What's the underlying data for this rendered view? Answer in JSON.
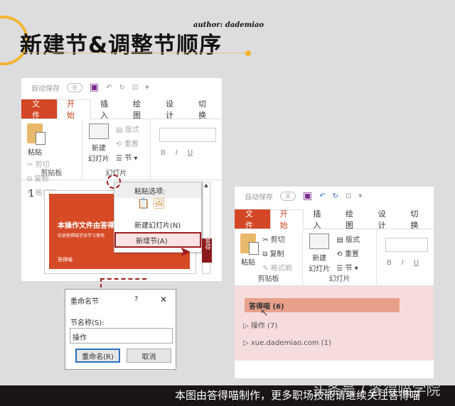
{
  "banner": {
    "title": "新建节&调整节顺序",
    "author": "author: dademiao"
  },
  "left_window": {
    "qat": {
      "autosave": "自动保存",
      "toggle": "关"
    },
    "tabs": [
      "文件",
      "开始",
      "插入",
      "绘图",
      "设计",
      "切换"
    ],
    "clipboard": {
      "paste": "粘贴",
      "cut": "剪切",
      "copy": "复制",
      "format_painter": "格式刷",
      "group": "剪贴板"
    },
    "slides": {
      "new_slide_1": "新建",
      "new_slide_2": "幻灯片",
      "layout": "版式",
      "reset": "重置",
      "section": "节",
      "group": "幻灯片"
    },
    "font": {
      "bold": "B",
      "italic": "I",
      "underline": "U"
    },
    "slide_number": "1",
    "thumb_title": "本操作文件由答得",
    "thumb_sub": "仅供答得喵学员学习使用",
    "thumb_logo": "答得喵",
    "context_menu": {
      "paste_options": "粘贴选项:",
      "new_slide": "新建幻灯片(N)",
      "add_section": "新增节(A)"
    },
    "badge": "答得"
  },
  "dialog": {
    "title": "重命名节",
    "help": "?",
    "close": "✕",
    "label": "节名称(S):",
    "value": "操作",
    "rename": "重命名(R)",
    "cancel": "取消"
  },
  "right_window": {
    "qat": {
      "autosave": "自动保存",
      "toggle": "关"
    },
    "tabs": [
      "文件",
      "开始",
      "插入",
      "绘图",
      "设计",
      "切换"
    ],
    "clipboard": {
      "paste": "粘贴",
      "cut": "剪切",
      "copy": "复制",
      "format_painter": "格式刷",
      "group": "剪贴板"
    },
    "slides": {
      "new_slide_1": "新建",
      "new_slide_2": "幻灯片",
      "layout": "版式",
      "reset": "重置",
      "section": "节",
      "group": "幻灯片"
    },
    "font": {
      "bold": "B",
      "italic": "I",
      "underline": "U"
    },
    "sections": [
      "答得喵 (6)",
      "操作 (7)",
      "xue.dademiao.com (1)"
    ]
  },
  "footer": {
    "text": "本图由答得喵制作，更多职场技能请继续关注答得喵",
    "watermark": "头条号 / 答得喵学院"
  }
}
